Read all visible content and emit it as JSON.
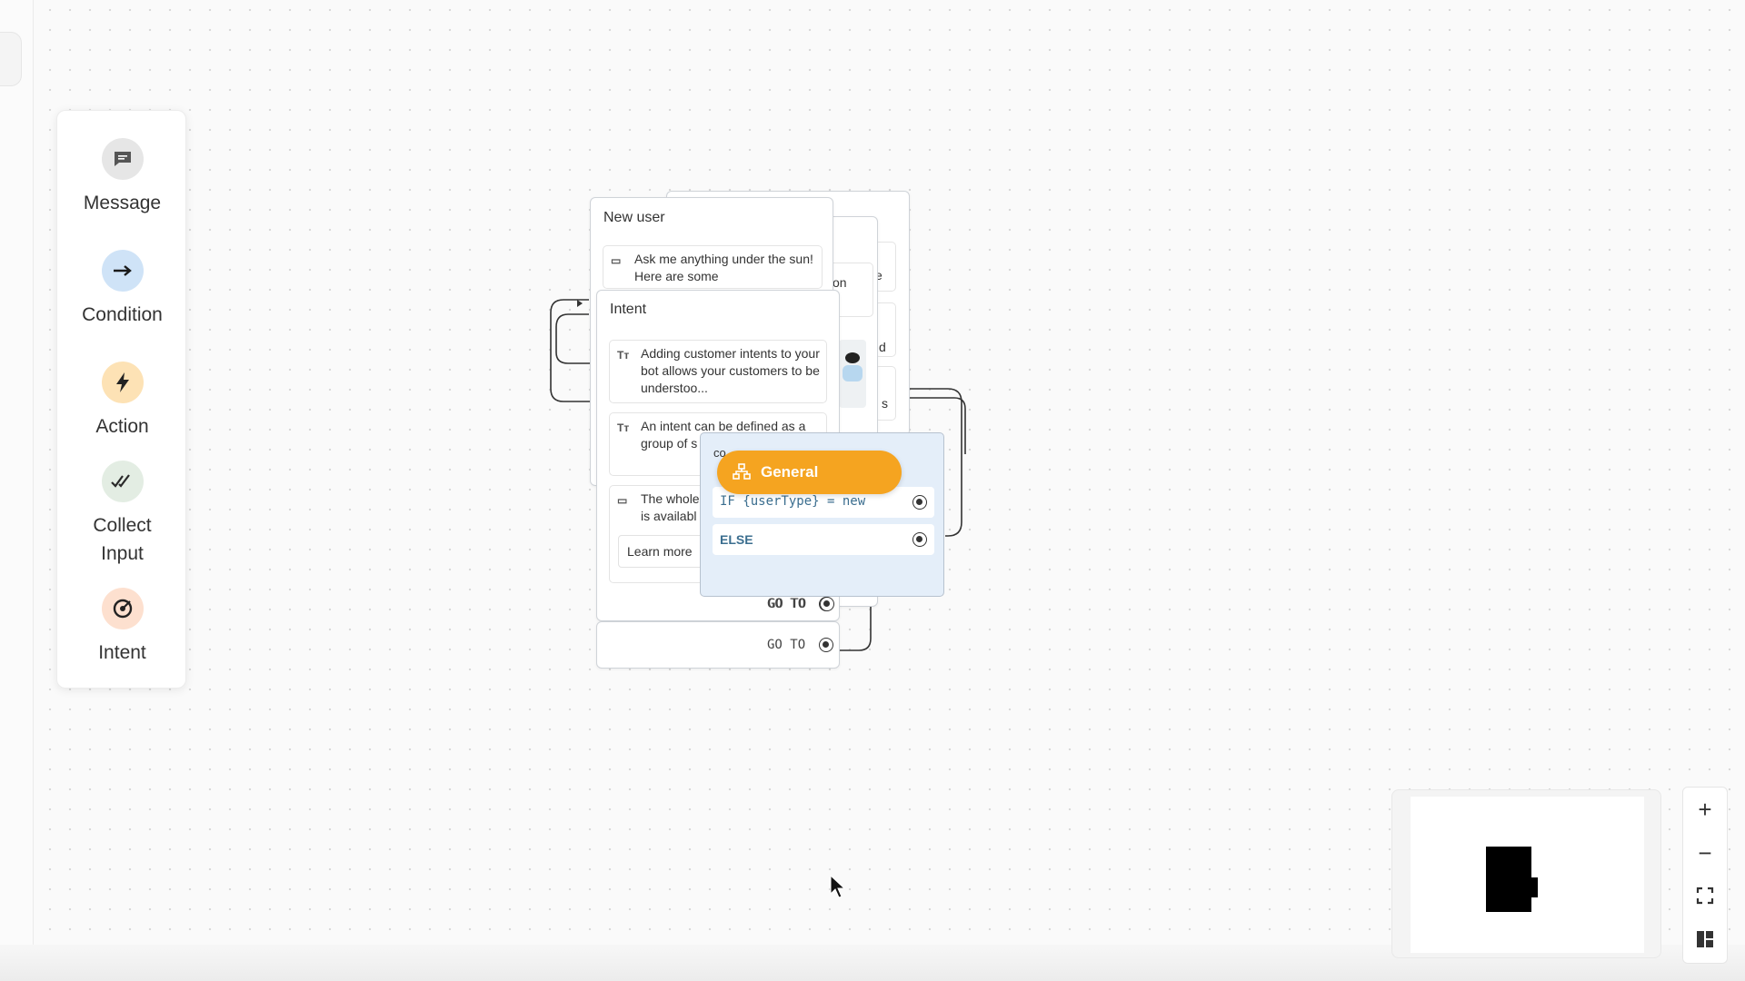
{
  "palette": {
    "items": [
      {
        "label": "Message",
        "icon": "message-icon",
        "color": "#6b6b6b"
      },
      {
        "label": "Condition",
        "icon": "arrow-right-icon",
        "color": "#cfe3f7"
      },
      {
        "label": "Action",
        "icon": "lightning-icon",
        "color": "#fde2b5"
      },
      {
        "label": "Collect Input",
        "icon": "double-check-icon",
        "color": "#e3ede3"
      },
      {
        "label": "Intent",
        "icon": "target-icon",
        "color": "#fde0cf"
      }
    ]
  },
  "nodes": {
    "new_user": {
      "title": "New user",
      "message": "Ask me anything under the sun! Here are some"
    },
    "intent": {
      "title": "Intent",
      "blocks": [
        "Adding customer intents to your bot allows your customers to be understoo...",
        "An intent can be defined as a group of s expressio",
        "The whole is availabl"
      ],
      "learn_more": "Learn more",
      "goto": "GO TO"
    },
    "back_node": {
      "goto": "GO TO",
      "fragments": [
        "on",
        "e",
        "d",
        "s"
      ]
    },
    "condition": {
      "header": "co",
      "badge": "General",
      "if_row": "IF {userType} = new",
      "else_row": "ELSE"
    }
  },
  "zoom": {
    "zoom_in": "+",
    "zoom_out": "−"
  },
  "colors": {
    "accent_orange": "#f5a420",
    "condition_bg": "#e4eef9"
  }
}
